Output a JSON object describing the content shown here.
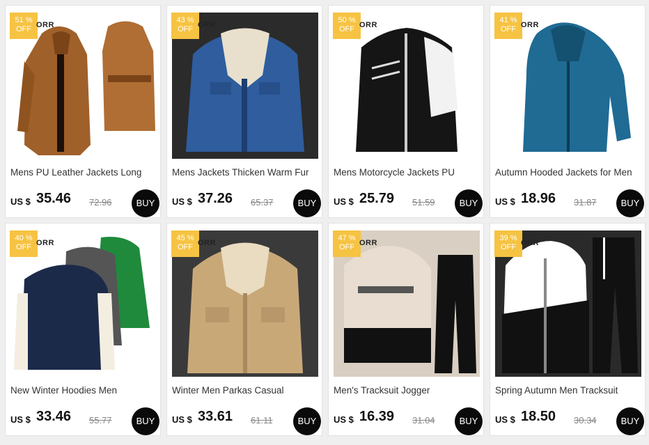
{
  "products": [
    {
      "title": "Mens PU Leather Jackets Long",
      "currency": "US $",
      "price": "35.46",
      "old_price": "72.96",
      "discount": "51 %",
      "off": "OFF",
      "brand": "ORR",
      "buy": "BUY",
      "colors": {
        "bg": "#ffffff",
        "main": "#a0602a",
        "accent": "#7a4418"
      }
    },
    {
      "title": "Mens Jackets Thicken Warm Fur",
      "currency": "US $",
      "price": "37.26",
      "old_price": "65.37",
      "discount": "43 %",
      "off": "OFF",
      "brand": "ORR",
      "buy": "BUY",
      "colors": {
        "bg": "#2b2b2b",
        "main": "#2f5d9e",
        "accent": "#e8e0cc"
      }
    },
    {
      "title": "Mens Motorcycle Jackets PU",
      "currency": "US $",
      "price": "25.79",
      "old_price": "51.59",
      "discount": "50 %",
      "off": "OFF",
      "brand": "ORR",
      "buy": "BUY",
      "colors": {
        "bg": "#ffffff",
        "main": "#151515",
        "accent": "#f2f2f2"
      }
    },
    {
      "title": "Autumn Hooded Jackets for Men",
      "currency": "US $",
      "price": "18.96",
      "old_price": "31.87",
      "discount": "41 %",
      "off": "OFF",
      "brand": "ORR",
      "buy": "BUY",
      "colors": {
        "bg": "#ffffff",
        "main": "#1f6b94",
        "accent": "#14506f"
      }
    },
    {
      "title": "New Winter Hoodies Men",
      "currency": "US $",
      "price": "33.46",
      "old_price": "55.77",
      "discount": "40 %",
      "off": "OFF",
      "brand": "ORR",
      "buy": "BUY",
      "colors": {
        "bg": "#ffffff",
        "main": "#1c2a4a",
        "accent": "#f3eee0"
      }
    },
    {
      "title": "Winter Men Parkas Casual",
      "currency": "US $",
      "price": "33.61",
      "old_price": "61.11",
      "discount": "45 %",
      "off": "OFF",
      "brand": "ORR",
      "buy": "BUY",
      "colors": {
        "bg": "#3a3a3a",
        "main": "#c9a878",
        "accent": "#e9dcc0"
      }
    },
    {
      "title": "Men's Tracksuit Jogger",
      "currency": "US $",
      "price": "16.39",
      "old_price": "31.04",
      "discount": "47 %",
      "off": "OFF",
      "brand": "ORR",
      "buy": "BUY",
      "colors": {
        "bg": "#d9cfc2",
        "main": "#e8ddd0",
        "accent": "#111111"
      }
    },
    {
      "title": "Spring Autumn Men Tracksuit",
      "currency": "US $",
      "price": "18.50",
      "old_price": "30.34",
      "discount": "39 %",
      "off": "OFF",
      "brand": "ORR",
      "buy": "BUY",
      "colors": {
        "bg": "#2a2a2a",
        "main": "#ffffff",
        "accent": "#111111"
      }
    }
  ]
}
